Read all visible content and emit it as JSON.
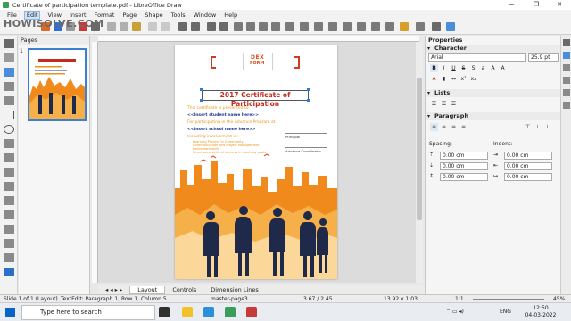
{
  "window": {
    "title": "Certificate of participation template.pdf - LibreOffice Draw",
    "minimize": "—",
    "maximize": "❐",
    "close": "✕"
  },
  "watermark": "HOWISOLVE.COM",
  "menu": [
    "File",
    "Edit",
    "View",
    "Insert",
    "Format",
    "Page",
    "Shape",
    "Tools",
    "Window",
    "Help"
  ],
  "pages_panel": {
    "header": "Pages",
    "page_number": "1"
  },
  "document": {
    "logo_top": "DEX",
    "logo_bottom": "FORM",
    "title": "2017 Certificate of Participation",
    "presented_to": "This certificate is presented to",
    "student_placeholder": "<<Insert student name here>>",
    "participating": "For participating in the Advance Program at",
    "school_placeholder": "<<Insert school name here>>",
    "including": "Including involvement in:",
    "bullets": [
      "Learning Process in Community",
      "Communication and Project Management",
      "Retirement skills",
      "To enhance skills of success in reaching goals"
    ],
    "principal": "Principal",
    "coordinator": "Advance Coordinator"
  },
  "sidebar": {
    "title": "Properties",
    "character": "Character",
    "font_name": "Arial",
    "font_size": "25.9 pt",
    "lists": "Lists",
    "paragraph": "Paragraph",
    "spacing": "Spacing:",
    "indent": "Indent:",
    "spacing_values": [
      "0.00 cm",
      "0.00 cm",
      "0.00 cm"
    ],
    "indent_values": [
      "0.00 cm",
      "0.00 cm",
      "0.00 cm"
    ]
  },
  "tabs": [
    "Layout",
    "Controls",
    "Dimension Lines"
  ],
  "status": {
    "slide": "Slide 1 of 1 (Layout)",
    "edit": "TextEdit: Paragraph 1, Row 1, Column 5",
    "master": "master-page3",
    "position": "3.67 / 2.45",
    "size": "13.92 x 1.03",
    "ratio": "1:1",
    "zoom": "45%"
  },
  "taskbar": {
    "search_placeholder": "Type here to search",
    "lang": "ENG",
    "time": "12:50",
    "date": "04-03-2022"
  },
  "colors": {
    "accent": "#2a7ae2",
    "title_red": "#c42b1c",
    "city_orange": "#f08a1c"
  }
}
